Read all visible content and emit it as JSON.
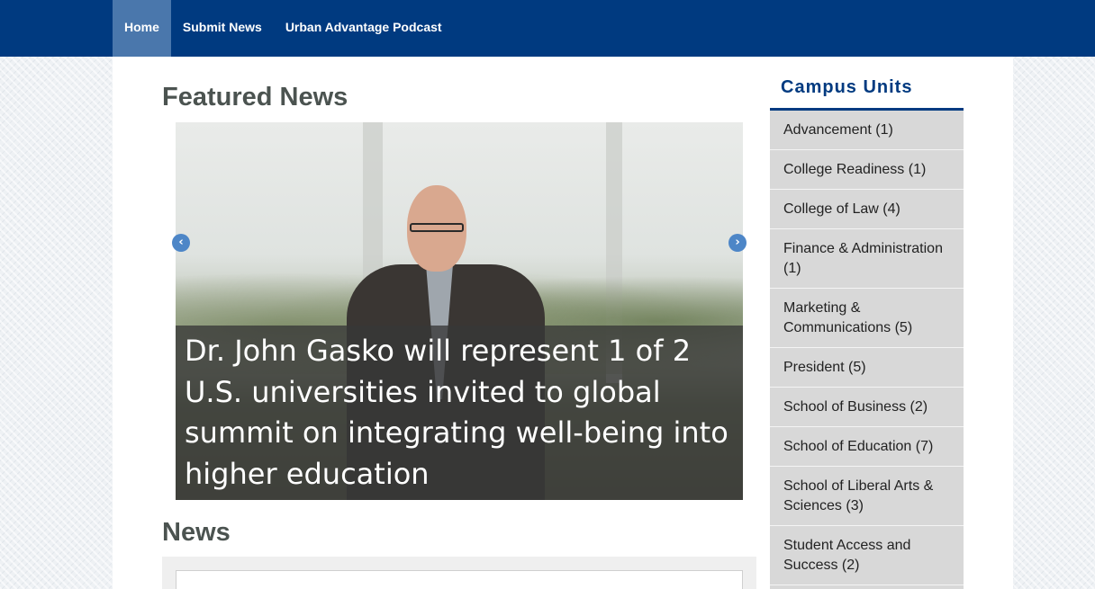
{
  "nav": {
    "items": [
      {
        "label": "Home",
        "active": true
      },
      {
        "label": "Submit News",
        "active": false
      },
      {
        "label": "Urban Advantage Podcast",
        "active": false
      }
    ]
  },
  "featured": {
    "title": "Featured News",
    "slide_caption": "Dr. John Gasko will represent 1 of 2 U.S. universities invited to global summit on integrating well-being into higher education",
    "prev_icon": "‹",
    "next_icon": "›"
  },
  "news": {
    "title": "News"
  },
  "sidebar": {
    "heading": "Campus Units",
    "items": [
      "Advancement (1)",
      "College Readiness (1)",
      "College of Law (4)",
      "Finance & Administration (1)",
      "Marketing & Communications (5)",
      "President (5)",
      "School of Business (2)",
      "School of Education (7)",
      "School of Liberal Arts & Sciences (3)",
      "Student Access and Success (2)",
      ""
    ]
  },
  "colors": {
    "nav_bg": "#003a80",
    "nav_active": "#4a77ac",
    "sidebar_item_bg": "#d8d8d8",
    "title_text": "#4b5350"
  }
}
